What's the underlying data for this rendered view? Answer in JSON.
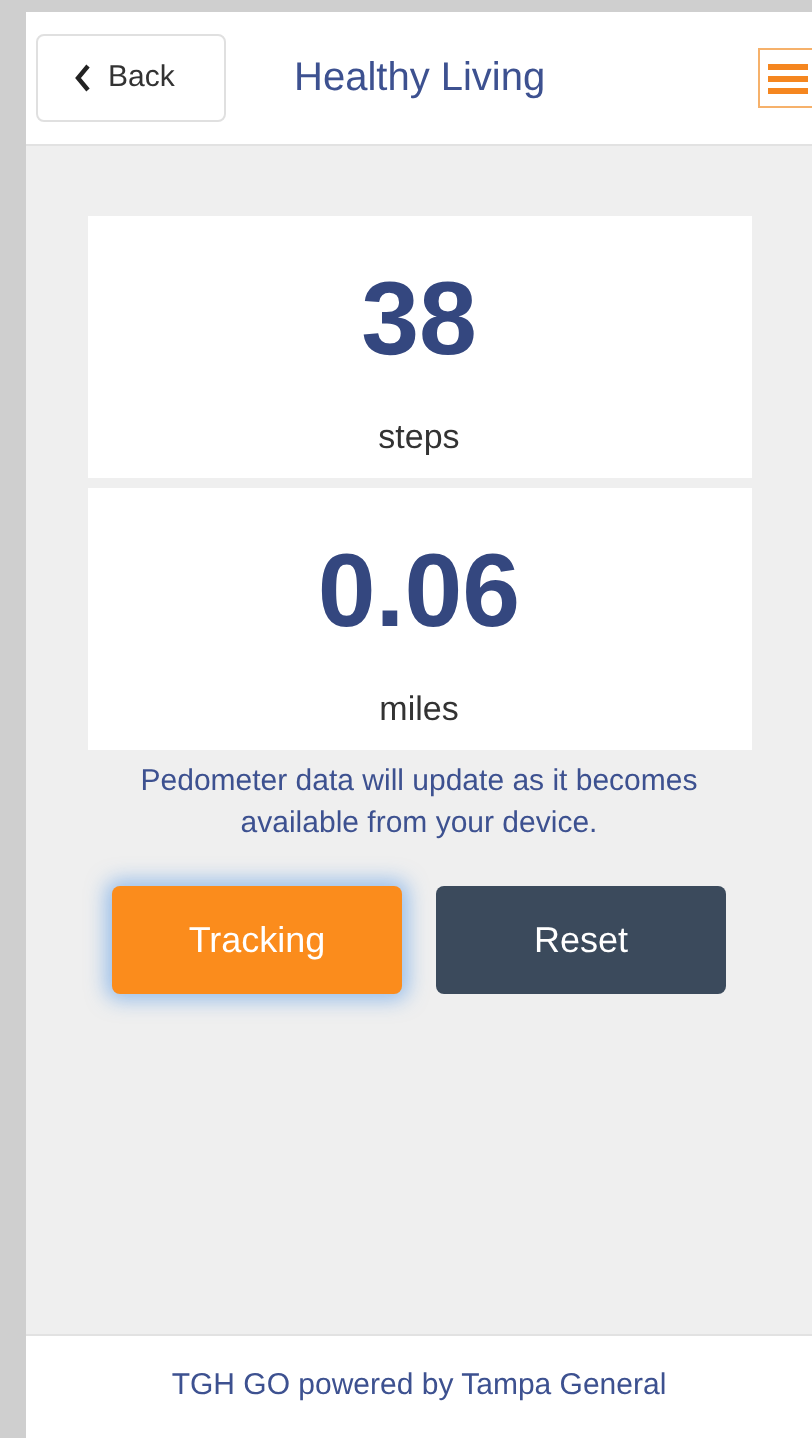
{
  "header": {
    "back": "Back",
    "title": "Healthy Living"
  },
  "stats": [
    {
      "value": "38",
      "unit": "steps"
    },
    {
      "value": "0.06",
      "unit": "miles"
    }
  ],
  "note": "Pedometer data will update as it becomes available from your device.",
  "buttons": [
    {
      "label": "Tracking",
      "kind": "primary",
      "focused": true
    },
    {
      "label": "Reset",
      "kind": "secondary",
      "focused": false
    }
  ],
  "footer": "TGH GO powered by Tampa General"
}
